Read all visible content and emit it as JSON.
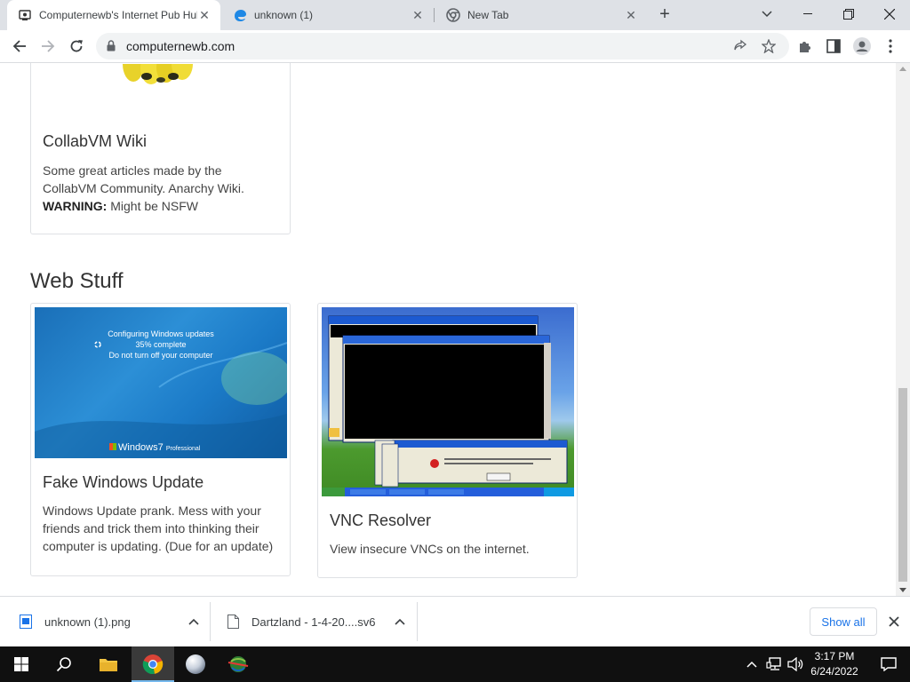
{
  "browser": {
    "tabs": [
      {
        "title": "Computernewb's Internet Pub Hub",
        "active": true,
        "icon": "computernewb-favicon"
      },
      {
        "title": "unknown (1)",
        "active": false,
        "icon": "edge-favicon"
      },
      {
        "title": "New Tab",
        "active": false,
        "icon": "chrome-favicon"
      }
    ],
    "url": "computernewb.com"
  },
  "page": {
    "wiki_card": {
      "title": "CollabVM Wiki",
      "text_line1": "Some great articles made by the",
      "text_line2": "CollabVM Community. Anarchy Wiki.",
      "warning_label": "WARNING:",
      "warning_text": " Might be NSFW"
    },
    "section_heading": "Web Stuff",
    "cards": [
      {
        "title": "Fake Windows Update",
        "text": "Windows Update prank. Mess with your friends and trick them into thinking their computer is updating. (Due for an update)",
        "thumb_line1": "Configuring Windows updates",
        "thumb_line2": "35% complete",
        "thumb_line3": "Do not turn off your computer",
        "thumb_brand": "Windows",
        "thumb_brand_version": "7",
        "thumb_brand_edition": "Professional"
      },
      {
        "title": "VNC Resolver",
        "text": "View insecure VNCs on the internet."
      }
    ]
  },
  "downloads": {
    "items": [
      {
        "name": "unknown (1).png",
        "icon": "image-file-icon"
      },
      {
        "name": "Dartzland - 1-4-20....sv6",
        "icon": "file-icon"
      }
    ],
    "show_all": "Show all"
  },
  "taskbar": {
    "time": "3:17 PM",
    "date": "6/24/2022"
  },
  "colors": {
    "tabstrip": "#dee1e6",
    "accent_link": "#1a73e8",
    "taskbar": "#101010"
  }
}
